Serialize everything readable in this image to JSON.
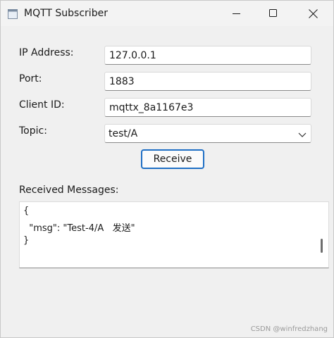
{
  "window": {
    "title": "MQTT Subscriber",
    "controls": {
      "minimize": "minimize",
      "maximize": "maximize",
      "close": "close"
    }
  },
  "form": {
    "ip_label": "IP Address:",
    "ip_value": "127.0.0.1",
    "port_label": "Port:",
    "port_value": "1883",
    "client_label": "Client ID:",
    "client_value": "mqttx_8a1167e3",
    "topic_label": "Topic:",
    "topic_value": "test/A"
  },
  "actions": {
    "receive_label": "Receive"
  },
  "messages": {
    "label": "Received Messages:",
    "lines": [
      "{",
      "  \"msg\": \"Test-4/A   发送\"",
      "}"
    ]
  },
  "watermark": "CSDN @winfredzhang",
  "icons": {
    "app": "app-icon",
    "minimize": "minimize-icon",
    "maximize": "maximize-icon",
    "close": "close-icon",
    "dropdown": "chevron-down-icon"
  },
  "colors": {
    "accent": "#1f6fc5",
    "background": "#f0f0f0"
  }
}
